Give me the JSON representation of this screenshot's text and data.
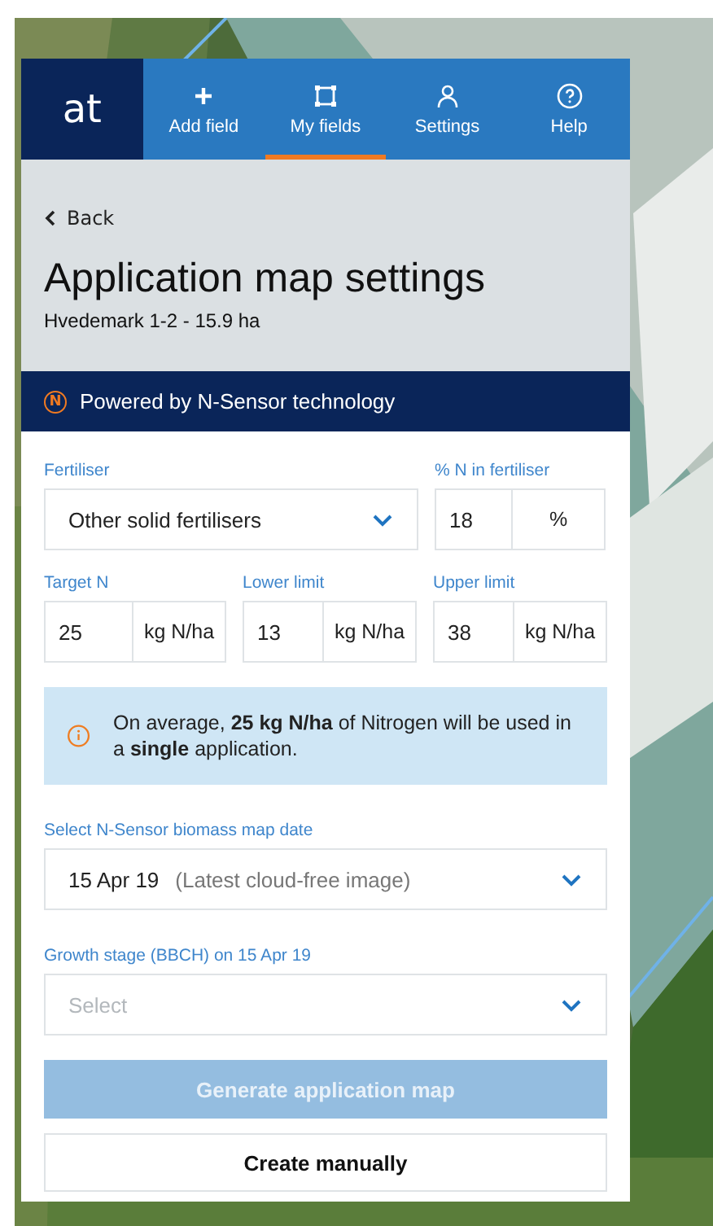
{
  "logo": "at",
  "nav": [
    {
      "label": "Add field",
      "selected": false
    },
    {
      "label": "My fields",
      "selected": true
    },
    {
      "label": "Settings",
      "selected": false
    },
    {
      "label": "Help",
      "selected": false
    }
  ],
  "back": "Back",
  "title": "Application map settings",
  "subtitle": "Hvedemark 1-2 - 15.9 ha",
  "banner": {
    "badge": "N",
    "text": "Powered by N-Sensor technology"
  },
  "fertiliser": {
    "label": "Fertiliser",
    "value": "Other solid fertilisers"
  },
  "percent": {
    "label": "% N in fertiliser",
    "value": "18",
    "unit": "%"
  },
  "limits": [
    {
      "label": "Target N",
      "value": "25",
      "unit": "kg N/ha"
    },
    {
      "label": "Lower limit",
      "value": "13",
      "unit": "kg N/ha"
    },
    {
      "label": "Upper limit",
      "value": "38",
      "unit": "kg N/ha"
    }
  ],
  "info": "On average, **25 kg N/ha** of Nitrogen will be used in a **single** application.",
  "map_date": {
    "label": "Select N-Sensor biomass map date",
    "value": "15 Apr 19",
    "note": "(Latest cloud-free image)"
  },
  "growth": {
    "label": "Growth stage (BBCH) on 15 Apr 19",
    "placeholder": "Select"
  },
  "buttons": [
    {
      "label": "Generate application map",
      "kind": "primary",
      "disabled": true
    },
    {
      "label": "Create manually",
      "kind": "secondary",
      "disabled": false
    }
  ]
}
